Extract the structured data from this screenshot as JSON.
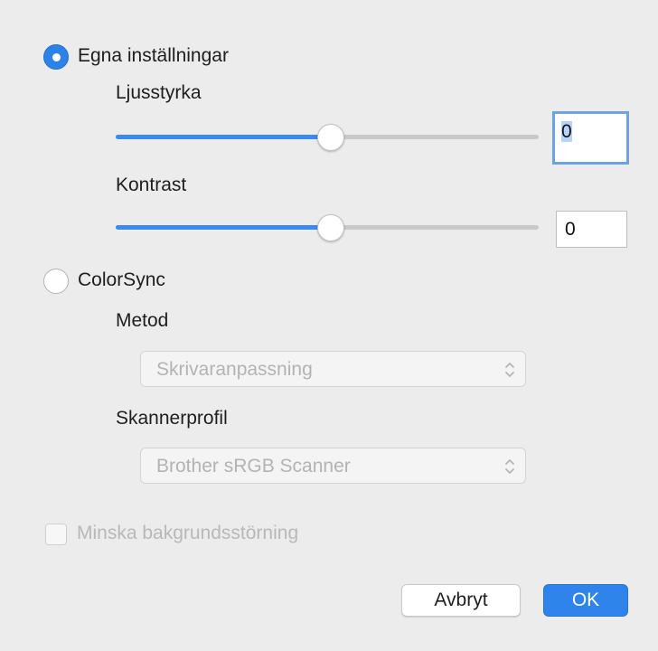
{
  "custom_settings": {
    "radio_label": "Egna inställningar",
    "selected": true,
    "brightness": {
      "label": "Ljusstyrka",
      "value": "0",
      "slider_fraction": 0.5
    },
    "contrast": {
      "label": "Kontrast",
      "value": "0",
      "slider_fraction": 0.5
    }
  },
  "colorsync": {
    "radio_label": "ColorSync",
    "selected": false,
    "method_label": "Metod",
    "method_value": "Skrivaranpassning",
    "profile_label": "Skannerprofil",
    "profile_value": "Brother sRGB Scanner"
  },
  "reduce_noise": {
    "label": "Minska bakgrundsstörning",
    "checked": false,
    "enabled": false
  },
  "buttons": {
    "cancel": "Avbryt",
    "ok": "OK"
  },
  "colors": {
    "accent": "#2f84ec",
    "slider_fill": "#3a8af0",
    "disabled_text": "#b3b3b3"
  }
}
